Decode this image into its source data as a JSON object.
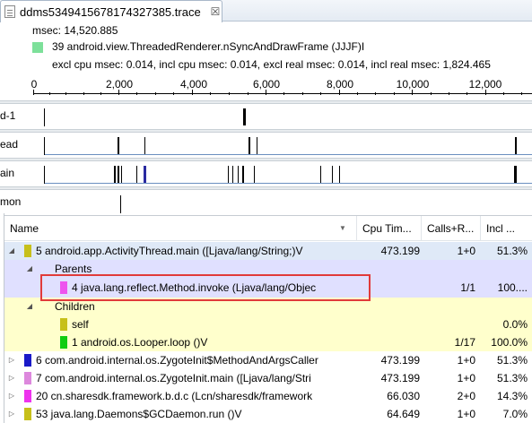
{
  "tab": {
    "title": "ddms5349415678174327385.trace",
    "icon": "trace-file-icon",
    "close_glyph": "☒"
  },
  "info": {
    "msec": "msec: 14,520.885",
    "method": "39 android.view.ThreadedRenderer.nSyncAndDrawFrame (JJJF)I",
    "method_color": "#7de09a",
    "stats": "excl cpu msec: 0.014, incl cpu msec: 0.014, excl real msec: 0.014, incl real msec: 1,824.465"
  },
  "timeline": {
    "ticks": [
      "0",
      "2,000",
      "4,000",
      "6,000",
      "8,000",
      "10,000",
      "12,000"
    ],
    "threads": [
      {
        "label": "d-1"
      },
      {
        "label": "ead"
      },
      {
        "label": "ain"
      },
      {
        "label": "mon"
      }
    ]
  },
  "table": {
    "columns": {
      "name": "Name",
      "cpu": "Cpu Tim...",
      "calls": "Calls+R...",
      "incl": "Incl ..."
    },
    "rows": [
      {
        "name": "5 android.app.ActivityThread.main ([Ljava/lang/String;)V",
        "color": "#c7c01a",
        "cpu": "473.199",
        "calls": "1+0",
        "incl": "51.3%"
      },
      {
        "name": "Parents",
        "color": "#c7c01a",
        "cpu": "",
        "calls": "",
        "incl": ""
      },
      {
        "name": "4 java.lang.reflect.Method.invoke (Ljava/lang/Objec",
        "color": "#ee55ee",
        "cpu": "",
        "calls": "1/1",
        "incl": "100...."
      },
      {
        "name": "Children",
        "color": "#c7c01a",
        "cpu": "",
        "calls": "",
        "incl": ""
      },
      {
        "name": "self",
        "color": "#c7c01a",
        "cpu": "",
        "calls": "",
        "incl": "0.0%"
      },
      {
        "name": "1 android.os.Looper.loop ()V",
        "color": "#11cc11",
        "cpu": "",
        "calls": "1/17",
        "incl": "100.0%"
      },
      {
        "name": "6 com.android.internal.os.ZygoteInit$MethodAndArgsCaller",
        "color": "#1a1ac8",
        "cpu": "473.199",
        "calls": "1+0",
        "incl": "51.3%"
      },
      {
        "name": "7 com.android.internal.os.ZygoteInit.main ([Ljava/lang/Stri",
        "color": "#dd88dd",
        "cpu": "473.199",
        "calls": "1+0",
        "incl": "51.3%"
      },
      {
        "name": "20 cn.sharesdk.framework.b.d.c (Lcn/sharesdk/framework",
        "color": "#ee33ee",
        "cpu": "66.030",
        "calls": "2+0",
        "incl": "14.3%"
      },
      {
        "name": "53 java.lang.Daemons$GCDaemon.run ()V",
        "color": "#c7c01a",
        "cpu": "64.649",
        "calls": "1+0",
        "incl": "7.0%"
      }
    ]
  }
}
